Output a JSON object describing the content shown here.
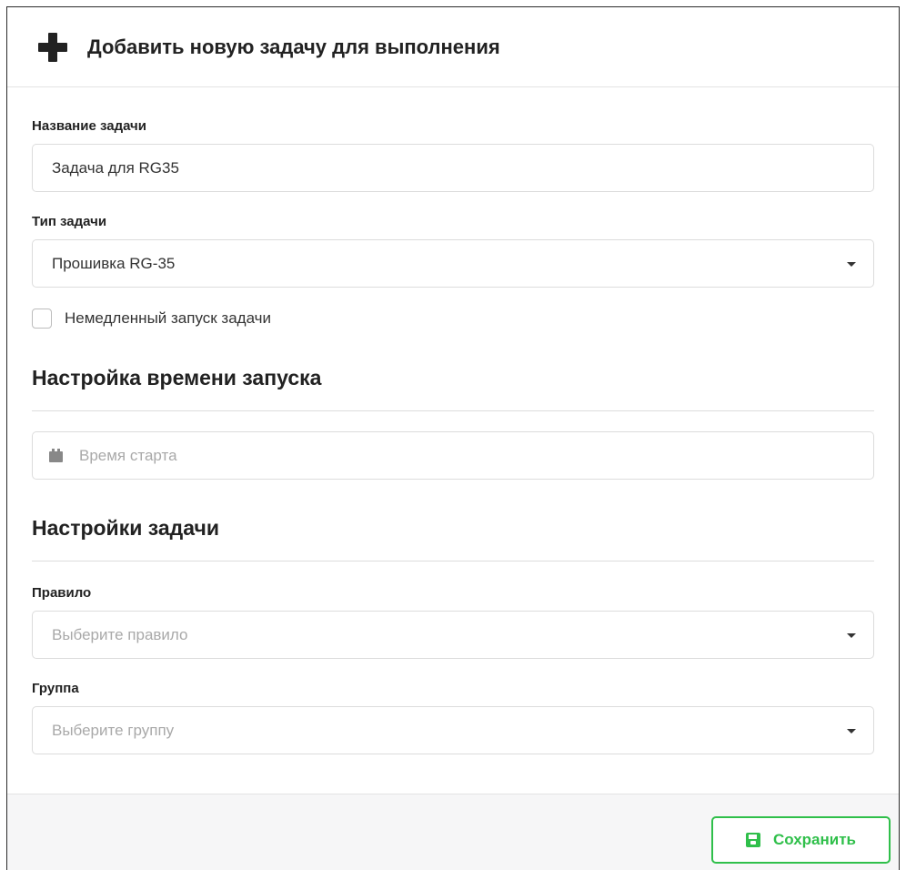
{
  "header": {
    "title": "Добавить новую задачу для выполнения",
    "icon": "plus-icon"
  },
  "form": {
    "task_name": {
      "label": "Название задачи",
      "value": "Задача для RG35"
    },
    "task_type": {
      "label": "Тип задачи",
      "value": "Прошивка RG-35"
    },
    "immediate_start": {
      "label": "Немедленный запуск задачи",
      "checked": false
    }
  },
  "schedule_section": {
    "title": "Настройка времени запуска",
    "start_time_placeholder": "Время старта",
    "icon": "calendar-icon"
  },
  "settings_section": {
    "title": "Настройки задачи",
    "rule": {
      "label": "Правило",
      "placeholder": "Выберите правило"
    },
    "group": {
      "label": "Группа",
      "placeholder": "Выберите группу"
    }
  },
  "footer": {
    "save_label": "Сохранить",
    "save_icon": "save-icon",
    "accent_color": "#2fbf4a"
  }
}
